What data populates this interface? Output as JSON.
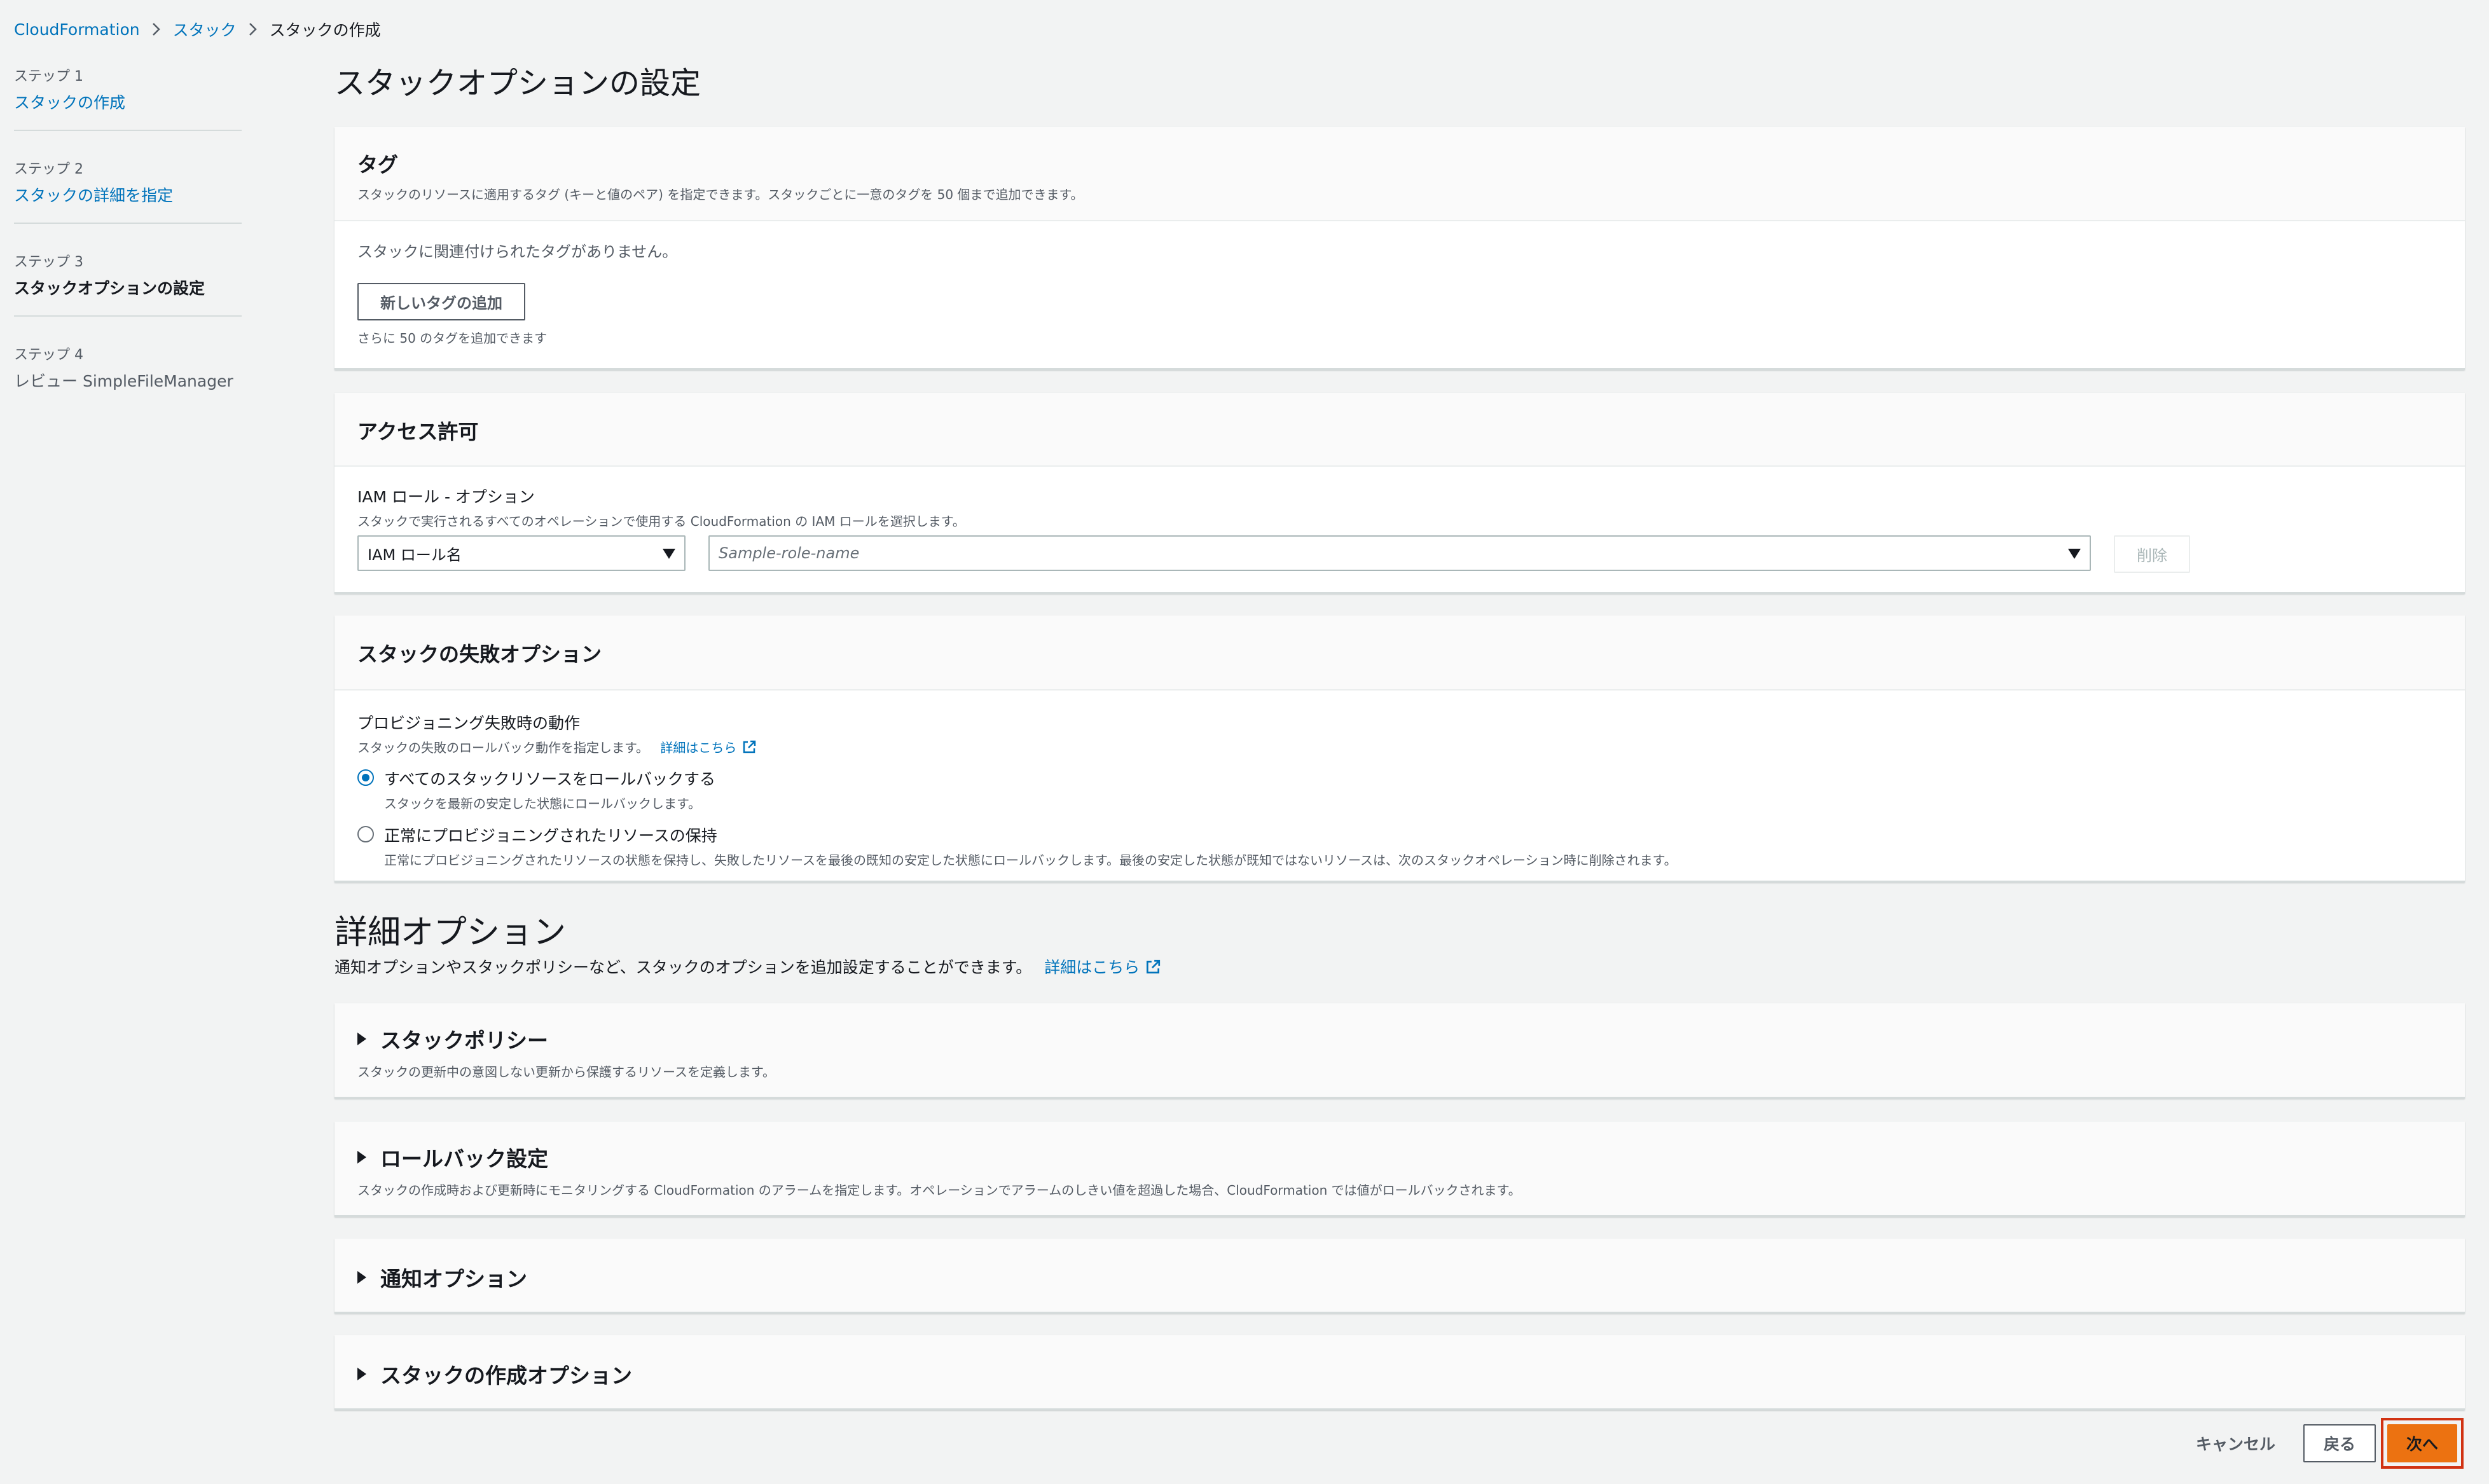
{
  "breadcrumb": {
    "items": [
      "CloudFormation",
      "スタック",
      "スタックの作成"
    ]
  },
  "steps": [
    {
      "num": "ステップ 1",
      "title": "スタックの作成"
    },
    {
      "num": "ステップ 2",
      "title": "スタックの詳細を指定"
    },
    {
      "num": "ステップ 3",
      "title": "スタックオプションの設定"
    },
    {
      "num": "ステップ 4",
      "title": "レビュー SimpleFileManager"
    }
  ],
  "page_title": "スタックオプションの設定",
  "tags": {
    "title": "タグ",
    "desc": "スタックのリソースに適用するタグ (キーと値のペア) を指定できます。スタックごとに一意のタグを 50 個まで追加できます。",
    "empty": "スタックに関連付けられたタグがありません。",
    "add_button": "新しいタグの追加",
    "remaining": "さらに 50 のタグを追加できます"
  },
  "permissions": {
    "title": "アクセス許可",
    "iam_label": "IAM ロール - オプション",
    "iam_desc": "スタックで実行されるすべてのオペレーションで使用する CloudFormation の IAM ロールを選択します。",
    "select_value": "IAM ロール名",
    "role_placeholder": "Sample-role-name",
    "remove_button": "削除"
  },
  "failure": {
    "title": "スタックの失敗オプション",
    "label": "プロビジョニング失敗時の動作",
    "desc": "スタックの失敗のロールバック動作を指定します。",
    "learn_more": "詳細はこちら",
    "options": [
      {
        "label": "すべてのスタックリソースをロールバックする",
        "desc": "スタックを最新の安定した状態にロールバックします。"
      },
      {
        "label": "正常にプロビジョニングされたリソースの保持",
        "desc": "正常にプロビジョニングされたリソースの状態を保持し、失敗したリソースを最後の既知の安定した状態にロールバックします。最後の安定した状態が既知ではないリソースは、次のスタックオペレーション時に削除されます。"
      }
    ]
  },
  "advanced": {
    "title": "詳細オプション",
    "desc": "通知オプションやスタックポリシーなど、スタックのオプションを追加設定することができます。",
    "learn_more": "詳細はこちら",
    "sections": [
      {
        "title": "スタックポリシー",
        "desc": "スタックの更新中の意図しない更新から保護するリソースを定義します。"
      },
      {
        "title": "ロールバック設定",
        "desc": "スタックの作成時および更新時にモニタリングする CloudFormation のアラームを指定します。オペレーションでアラームのしきい値を超過した場合、CloudFormation では値がロールバックされます。"
      },
      {
        "title": "通知オプション",
        "desc": ""
      },
      {
        "title": "スタックの作成オプション",
        "desc": ""
      }
    ]
  },
  "footer": {
    "cancel": "キャンセル",
    "back": "戻る",
    "next": "次へ"
  }
}
